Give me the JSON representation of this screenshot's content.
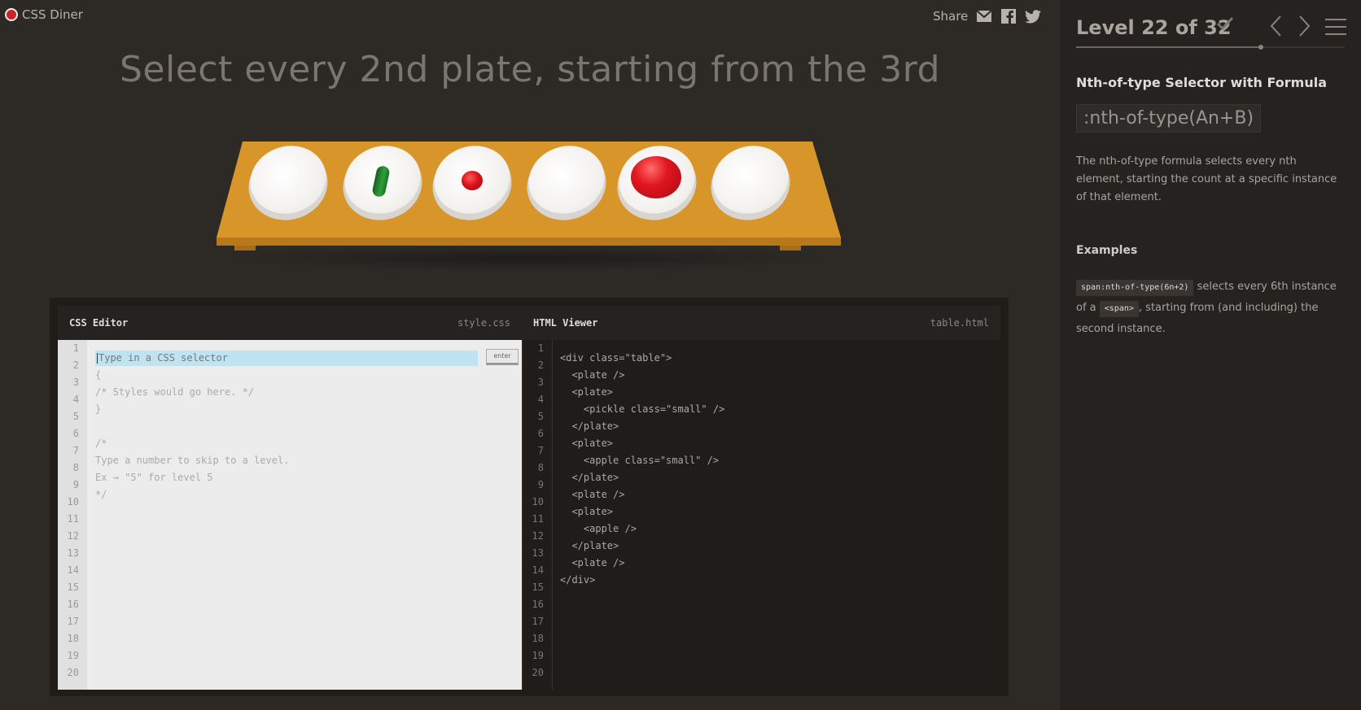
{
  "app": {
    "name": "CSS Diner"
  },
  "share": {
    "label": "Share",
    "icons": [
      "email-icon",
      "facebook-icon",
      "twitter-icon"
    ]
  },
  "instruction": "Select every 2nd plate, starting from the 3rd",
  "table": {
    "items": [
      {
        "type": "plate",
        "content": "none"
      },
      {
        "type": "plate",
        "content": "pickle small"
      },
      {
        "type": "plate",
        "content": "apple small"
      },
      {
        "type": "plate",
        "content": "none"
      },
      {
        "type": "plate",
        "content": "apple"
      },
      {
        "type": "plate",
        "content": "none"
      }
    ]
  },
  "css_editor": {
    "title": "CSS Editor",
    "file": "style.css",
    "placeholder": "Type in a CSS selector",
    "enter_label": "enter",
    "lines": [
      "",
      "{",
      "/* Styles would go here. */",
      "}",
      "",
      "/*",
      "Type a number to skip to a level.",
      "Ex → \"5\" for level 5",
      "*/"
    ],
    "line_numbers": [
      "1",
      "2",
      "3",
      "4",
      "5",
      "6",
      "7",
      "8",
      "9",
      "10",
      "11",
      "12",
      "13",
      "14",
      "15",
      "16",
      "17",
      "18",
      "19",
      "20"
    ]
  },
  "html_viewer": {
    "title": "HTML Viewer",
    "file": "table.html",
    "lines": [
      "<div class=\"table\">",
      "  <plate />",
      "  <plate>",
      "    <pickle class=\"small\" />",
      "  </plate>",
      "  <plate>",
      "    <apple class=\"small\" />",
      "  </plate>",
      "  <plate />",
      "  <plate>",
      "    <apple />",
      "  </plate>",
      "  <plate />",
      "</div>"
    ],
    "line_numbers": [
      "1",
      "2",
      "3",
      "4",
      "5",
      "6",
      "7",
      "8",
      "9",
      "10",
      "11",
      "12",
      "13",
      "14",
      "15",
      "16",
      "17",
      "18",
      "19",
      "20"
    ]
  },
  "sidebar": {
    "level_title": "Level 22 of 32",
    "level_progress": 0.6875,
    "completed": true,
    "selector_name": "Nth-of-type Selector with Formula",
    "syntax": ":nth-of-type(An+B)",
    "hint": "The nth-of-type formula selects every nth element, starting the count at a specific instance of that element.",
    "examples_title": "Examples",
    "example": {
      "code": "span:nth-of-type(6n+2)",
      "text1": "selects every 6th instance of a",
      "code2": "<span>",
      "text2": ", starting from (and including) the second instance."
    }
  },
  "colors": {
    "background": "#2d2a26",
    "sidebar": "#252220",
    "table": "#d89a2c",
    "apple": "#d8141c",
    "pickle": "#2fa03b",
    "input_highlight": "#bfe3f1"
  }
}
